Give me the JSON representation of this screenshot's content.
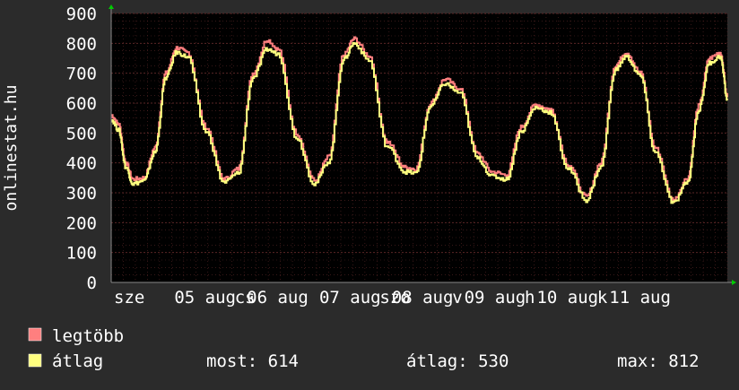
{
  "ylabel": "onlinestat.hu",
  "colors": {
    "background": "#2b2b2b",
    "plot_background": "#000000",
    "grid": "#5a2626",
    "text": "#ffffff",
    "legtobb": "#ff7f7f",
    "atlag": "#ffff7f",
    "arrow": "#00cc00"
  },
  "legend": {
    "items": [
      {
        "label": "legtöbb",
        "color": "#ff7f7f"
      },
      {
        "label": "átlag",
        "color": "#ffff7f"
      }
    ]
  },
  "stats": {
    "most": "most: 614",
    "atlag": "átlag: 530",
    "max": "max: 812"
  },
  "chart_data": {
    "type": "line",
    "ylim": [
      0,
      900
    ],
    "yticks": [
      0,
      100,
      200,
      300,
      400,
      500,
      600,
      700,
      800,
      900
    ],
    "xlim": [
      0,
      8.5
    ],
    "xticks": [
      {
        "x": 0.0,
        "label": "sze"
      },
      {
        "x": 0.833,
        "label": "05 aug"
      },
      {
        "x": 1.667,
        "label": "cs"
      },
      {
        "x": 1.833,
        "label": "06 aug"
      },
      {
        "x": 2.833,
        "label": "07 aug"
      },
      {
        "x": 3.667,
        "label": "szo"
      },
      {
        "x": 3.833,
        "label": "08 aug"
      },
      {
        "x": 4.667,
        "label": "v"
      },
      {
        "x": 4.833,
        "label": "09 aug"
      },
      {
        "x": 5.667,
        "label": "h"
      },
      {
        "x": 5.833,
        "label": "10 aug"
      },
      {
        "x": 6.667,
        "label": "k"
      },
      {
        "x": 6.833,
        "label": "11 aug"
      }
    ],
    "grid": true,
    "series": [
      {
        "name": "legtöbb",
        "color": "#ff7f7f",
        "points": [
          [
            0,
            560
          ],
          [
            0.1,
            530
          ],
          [
            0.2,
            400
          ],
          [
            0.3,
            345
          ],
          [
            0.45,
            350
          ],
          [
            0.6,
            450
          ],
          [
            0.75,
            700
          ],
          [
            0.9,
            785
          ],
          [
            1.05,
            770
          ],
          [
            1.3,
            520
          ],
          [
            1.55,
            345
          ],
          [
            1.75,
            380
          ],
          [
            1.95,
            700
          ],
          [
            2.15,
            812
          ],
          [
            2.3,
            780
          ],
          [
            2.55,
            500
          ],
          [
            2.8,
            340
          ],
          [
            3.0,
            420
          ],
          [
            3.2,
            760
          ],
          [
            3.35,
            815
          ],
          [
            3.55,
            760
          ],
          [
            3.8,
            470
          ],
          [
            4.05,
            385
          ],
          [
            4.2,
            380
          ],
          [
            4.4,
            600
          ],
          [
            4.6,
            680
          ],
          [
            4.8,
            650
          ],
          [
            5.05,
            430
          ],
          [
            5.25,
            370
          ],
          [
            5.45,
            360
          ],
          [
            5.65,
            520
          ],
          [
            5.85,
            595
          ],
          [
            6.05,
            580
          ],
          [
            6.3,
            395
          ],
          [
            6.55,
            285
          ],
          [
            6.75,
            400
          ],
          [
            6.95,
            725
          ],
          [
            7.1,
            770
          ],
          [
            7.3,
            700
          ],
          [
            7.5,
            450
          ],
          [
            7.75,
            275
          ],
          [
            7.95,
            350
          ],
          [
            8.1,
            590
          ],
          [
            8.25,
            750
          ],
          [
            8.4,
            770
          ],
          [
            8.5,
            620
          ]
        ]
      },
      {
        "name": "átlag",
        "color": "#ffff7f",
        "points": [
          [
            0,
            545
          ],
          [
            0.1,
            510
          ],
          [
            0.2,
            385
          ],
          [
            0.3,
            330
          ],
          [
            0.45,
            340
          ],
          [
            0.6,
            435
          ],
          [
            0.75,
            685
          ],
          [
            0.9,
            770
          ],
          [
            1.05,
            755
          ],
          [
            1.3,
            505
          ],
          [
            1.55,
            335
          ],
          [
            1.75,
            365
          ],
          [
            1.95,
            685
          ],
          [
            2.15,
            780
          ],
          [
            2.3,
            765
          ],
          [
            2.55,
            485
          ],
          [
            2.8,
            330
          ],
          [
            3.0,
            405
          ],
          [
            3.2,
            745
          ],
          [
            3.35,
            800
          ],
          [
            3.55,
            745
          ],
          [
            3.8,
            455
          ],
          [
            4.05,
            370
          ],
          [
            4.2,
            365
          ],
          [
            4.4,
            590
          ],
          [
            4.6,
            665
          ],
          [
            4.8,
            635
          ],
          [
            5.05,
            415
          ],
          [
            5.25,
            355
          ],
          [
            5.45,
            345
          ],
          [
            5.65,
            505
          ],
          [
            5.85,
            585
          ],
          [
            6.05,
            570
          ],
          [
            6.3,
            380
          ],
          [
            6.55,
            275
          ],
          [
            6.75,
            385
          ],
          [
            6.95,
            710
          ],
          [
            7.1,
            755
          ],
          [
            7.3,
            690
          ],
          [
            7.5,
            435
          ],
          [
            7.75,
            265
          ],
          [
            7.95,
            335
          ],
          [
            8.1,
            575
          ],
          [
            8.25,
            735
          ],
          [
            8.4,
            755
          ],
          [
            8.5,
            610
          ]
        ]
      }
    ]
  }
}
